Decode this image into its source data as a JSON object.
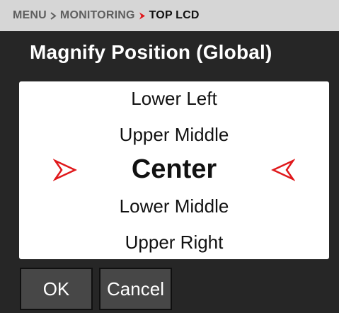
{
  "breadcrumb": {
    "items": [
      "MENU",
      "MONITORING",
      "TOP LCD"
    ],
    "accent_color": "#e0181b"
  },
  "title": "Magnify Position (Global)",
  "selector": {
    "options": [
      "Lower Left",
      "Upper Middle",
      "Center",
      "Lower Middle",
      "Upper Right"
    ],
    "selected": "Center",
    "indicator_color": "#e0181b"
  },
  "buttons": {
    "ok": "OK",
    "cancel": "Cancel"
  }
}
